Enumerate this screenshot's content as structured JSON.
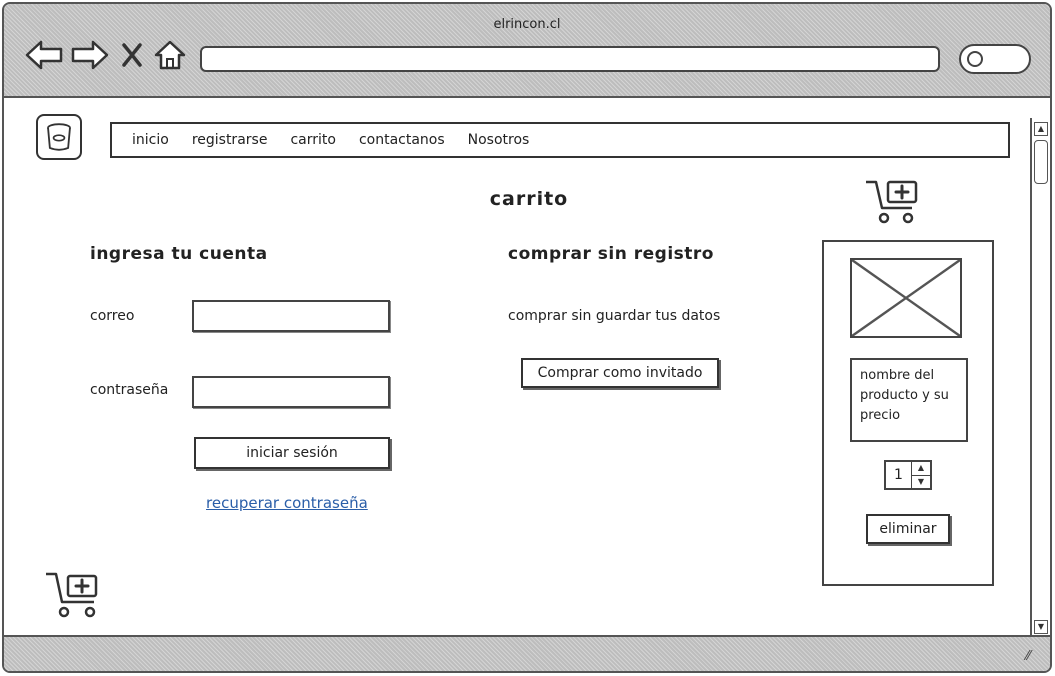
{
  "window": {
    "title": "elrincon.cl",
    "icons": {
      "back": "arrow-left-icon",
      "forward": "arrow-right-icon",
      "stop": "close-icon",
      "home": "home-icon",
      "search": "search-icon",
      "resize": "resize-grip-icon"
    }
  },
  "nav": {
    "logo_icon": "trash-bin-icon",
    "items": [
      "inicio",
      "registrarse",
      "carrito",
      "contactanos",
      "Nosotros"
    ]
  },
  "page": {
    "title": "carrito",
    "cart_icon": "shopping-cart-add-icon"
  },
  "login": {
    "heading": "ingresa tu cuenta",
    "email_label": "correo",
    "email_value": "",
    "password_label": "contraseña",
    "password_value": "",
    "submit_label": "iniciar sesión",
    "recover_link": "recuperar contraseña"
  },
  "guest": {
    "heading": "comprar sin registro",
    "description": "comprar sin guardar tus datos",
    "button_label": "Comprar como invitado"
  },
  "cart": {
    "image_placeholder": "image-placeholder-icon",
    "product_text": "nombre del producto y su precio",
    "quantity": "1",
    "remove_label": "eliminar"
  },
  "colors": {
    "link": "#2a5ea8",
    "chrome": "#c8c8c8",
    "border": "#444444"
  }
}
